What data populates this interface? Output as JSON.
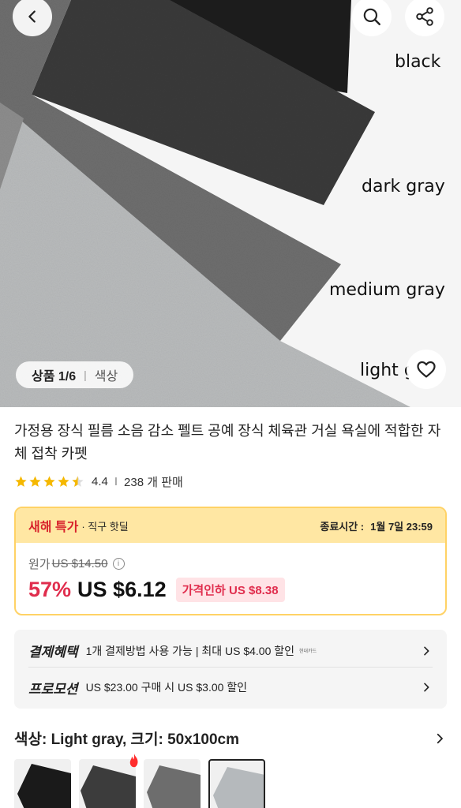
{
  "hero": {
    "swatch_labels": [
      "black",
      "dark gray",
      "medium gray",
      "light g"
    ],
    "image_counter": "상품 1/6",
    "image_category": "색상"
  },
  "nav": {
    "back_icon": "chevron-left-icon",
    "search_icon": "search-icon",
    "share_icon": "share-icon",
    "like_icon": "heart-icon"
  },
  "product": {
    "title": "가정용 장식 필름 소음 감소 펠트 공예 장식 체육관 거실 욕실에 적합한 자체 접착 카펫",
    "rating": "4.4",
    "sold": "238 개 판매",
    "stars_filled": 4.4
  },
  "deal": {
    "promo_name": "새해 특가",
    "promo_sub": "· 직구 핫딜",
    "end_label": "종료시간 :",
    "end_time": "1월 7일 23:59",
    "original_label": "원가",
    "original_price": "US $14.50",
    "discount": "57%",
    "price": "US $6.12",
    "price_drop": "가격인하 US $8.38"
  },
  "benefits": {
    "payment_label": "결제혜택",
    "payment_text": "1개 결제방법 사용 가능 | 최대 US $4.00 할인",
    "payment_tag": "현대카드",
    "promotion_label": "프로모션",
    "promotion_text": "US $23.00 구매 시 US $3.00 할인"
  },
  "options": {
    "selection": "색상: Light gray, 크기: 50x100cm",
    "thumbnails": [
      "black",
      "dark gray",
      "medium gray",
      "light gray"
    ],
    "hot_icon": "fire-icon"
  },
  "colors": {
    "accent_red": "#e02d4d",
    "deal_banner": "#ffe7a3",
    "deal_border": "#ffd265",
    "star": "#f5b800"
  }
}
